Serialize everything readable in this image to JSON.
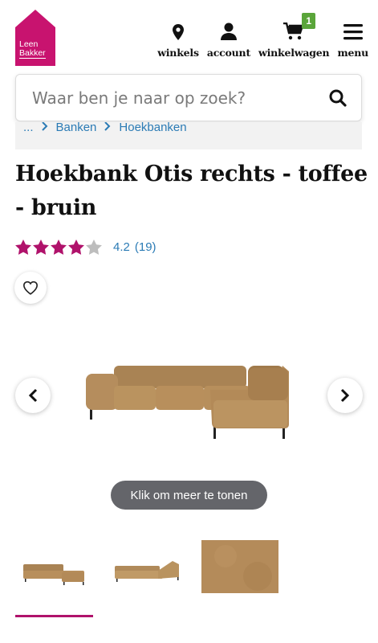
{
  "brand": {
    "logo_text_line1": "Leen",
    "logo_text_line2": "Bakker",
    "color": "#c8136f"
  },
  "nav": [
    {
      "icon": "location-pin-icon",
      "label": "winkels"
    },
    {
      "icon": "user-icon",
      "label": "account"
    },
    {
      "icon": "cart-icon",
      "label": "winkelwagen",
      "badge": "1"
    },
    {
      "icon": "hamburger-menu-icon",
      "label": "menu"
    }
  ],
  "search": {
    "placeholder": "Waar ben je naar op zoek?",
    "value": ""
  },
  "breadcrumb": {
    "items": [
      "...",
      "Banken",
      "Hoekbanken"
    ]
  },
  "product": {
    "title": "Hoekbank Otis rechts - toffee - bruin",
    "rating": {
      "value": "4.2",
      "count": "(19)",
      "stars_filled": 4.2,
      "max": 5
    }
  },
  "gallery": {
    "more_label": "Klik om meer te tonen"
  },
  "colors": {
    "accent": "#b0126b",
    "link": "#2b7bb5",
    "badge": "#5aa53a",
    "sofa": "#b9915c"
  }
}
